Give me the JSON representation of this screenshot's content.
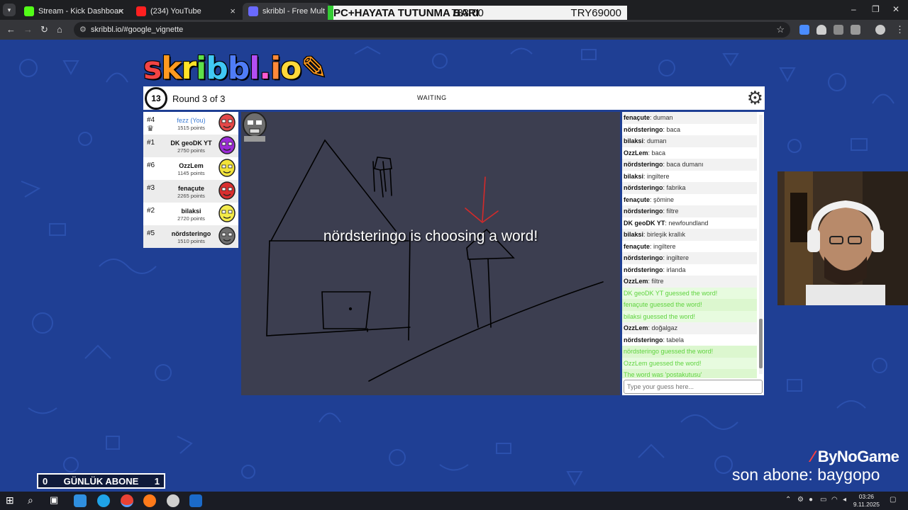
{
  "browser": {
    "tabs": [
      {
        "label": "Stream - Kick Dashboard",
        "icon": "kick-icon"
      },
      {
        "label": "(234) YouTube",
        "icon": "youtube-icon"
      },
      {
        "label": "skribbl - Free Multiplayer D",
        "icon": "skribbl-icon"
      }
    ],
    "url": "skribbl.io/#google_vignette"
  },
  "overlay_ticker": {
    "title": "PC+HAYATA TUTUNMA BARI",
    "current": "783.00",
    "goal": "TRY69000"
  },
  "game": {
    "logo": "skribbl.io",
    "timer": "13",
    "round": "Round 3 of 3",
    "status": "WAITING",
    "choosing_message": "nördsteringo is choosing a word!",
    "players": [
      {
        "rank": "#4",
        "name": "fezz (You)",
        "points": "1515 points",
        "color": "#e34848",
        "you": true
      },
      {
        "rank": "#1",
        "name": "DK geoDK YT",
        "points": "2750 points",
        "color": "#9b2bd6"
      },
      {
        "rank": "#6",
        "name": "OzzLem",
        "points": "1145 points",
        "color": "#f2e33a"
      },
      {
        "rank": "#3",
        "name": "fenaçute",
        "points": "2265 points",
        "color": "#d92e2e"
      },
      {
        "rank": "#2",
        "name": "bilaksi",
        "points": "2720 points",
        "color": "#f3ea4a"
      },
      {
        "rank": "#5",
        "name": "nördsteringo",
        "points": "1510 points",
        "color": "#6f6f6f"
      }
    ],
    "chat": [
      {
        "user": "fenaçute",
        "text": "duman"
      },
      {
        "user": "nördsteringo",
        "text": "baca"
      },
      {
        "user": "bilaksi",
        "text": "duman"
      },
      {
        "user": "OzzLem",
        "text": "baca"
      },
      {
        "user": "nördsteringo",
        "text": "baca dumanı"
      },
      {
        "user": "bilaksi",
        "text": "ingiltere"
      },
      {
        "user": "nördsteringo",
        "text": "fabrika"
      },
      {
        "user": "fenaçute",
        "text": "şömine"
      },
      {
        "user": "nördsteringo",
        "text": "filtre"
      },
      {
        "user": "DK geoDK YT",
        "text": "newfoundland"
      },
      {
        "user": "bilaksi",
        "text": "birleşik krallık"
      },
      {
        "user": "fenaçute",
        "text": "ingiltere"
      },
      {
        "user": "nördsteringo",
        "text": "ingiltere"
      },
      {
        "user": "nördsteringo",
        "text": "irlanda"
      },
      {
        "user": "OzzLem",
        "text": "filtre"
      },
      {
        "system": "DK geoDK YT guessed the word!"
      },
      {
        "system": "fenaçute guessed the word!"
      },
      {
        "system": "bilaksi guessed the word!"
      },
      {
        "user": "OzzLem",
        "text": "doğalgaz"
      },
      {
        "user": "nördsteringo",
        "text": "tabela"
      },
      {
        "system": "nördsteringo guessed the word!"
      },
      {
        "system": "OzzLem guessed the word!"
      },
      {
        "system": "The word was 'postakutusu'"
      }
    ],
    "guess_placeholder": "Type your guess here..."
  },
  "stream_overlay": {
    "subs_left": "0",
    "subs_label": "GÜNLÜK ABONE",
    "subs_right": "1",
    "brand": "ByNoGame",
    "last_sub": "son abone: baygopo"
  },
  "taskbar": {
    "time": "03:26",
    "date": "9.11.2025"
  }
}
